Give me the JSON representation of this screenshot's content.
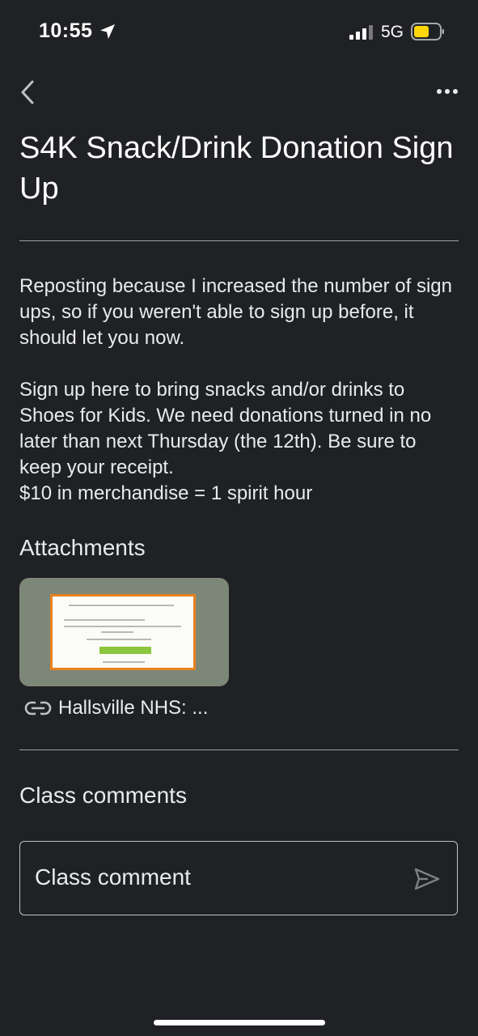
{
  "status_bar": {
    "time": "10:55",
    "network": "5G",
    "icons": [
      "location-arrow-icon",
      "signal-bars-icon",
      "battery-icon"
    ],
    "battery_color": "#ffd60a"
  },
  "toolbar": {
    "back_icon": "chevron-left-icon",
    "more_icon": "more-horizontal-icon"
  },
  "post": {
    "title": "S4K Snack/Drink Donation Sign Up",
    "paragraphs": [
      "Reposting because I increased the number of sign ups, so if you weren't able to sign up before, it should let you now.",
      "Sign up here to bring snacks and/or drinks to Shoes for Kids. We need donations turned in no later than next Thursday (the 12th). Be sure to keep your receipt.\n$10 in merchandise = 1 spirit hour"
    ]
  },
  "attachments": {
    "heading": "Attachments",
    "items": [
      {
        "label": "Hallsville NHS: ...",
        "icon": "link-icon"
      }
    ]
  },
  "comments": {
    "heading": "Class comments",
    "placeholder": "Class comment",
    "send_icon": "send-icon"
  },
  "colors": {
    "background": "#202124",
    "text": "#e8eaed",
    "divider": "#9aa0a6",
    "thumbnail_border": "#e8821f",
    "thumbnail_button": "#8cc63f"
  }
}
